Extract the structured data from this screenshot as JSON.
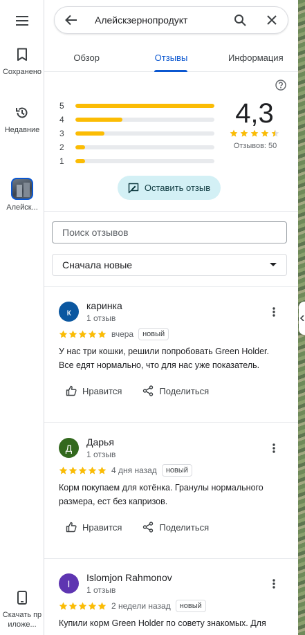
{
  "rail": {
    "saved_label": "Сохранено",
    "recent_label": "Недавние",
    "place_label": "Алейск...",
    "download_label": "Скачать приложе..."
  },
  "search": {
    "query": "Алейскзернопродукт"
  },
  "tabs": [
    {
      "label": "Обзор"
    },
    {
      "label": "Отзывы"
    },
    {
      "label": "Информация"
    }
  ],
  "rating": {
    "score": "4,3",
    "stars": 4.5,
    "count_text": "Отзывов: 50",
    "distribution": [
      {
        "stars": "5",
        "fraction": 1.0
      },
      {
        "stars": "4",
        "fraction": 0.34
      },
      {
        "stars": "3",
        "fraction": 0.21
      },
      {
        "stars": "2",
        "fraction": 0.07
      },
      {
        "stars": "1",
        "fraction": 0.07
      }
    ]
  },
  "write_review_label": "Оставить отзыв",
  "review_search_placeholder": "Поиск отзывов",
  "sort_label": "Сначала новые",
  "colors": {
    "accent": "#0b57d0",
    "star": "#fbbc04",
    "avatar_1": "#0b57a0",
    "avatar_2": "#33691e",
    "avatar_3": "#5e35b1"
  },
  "reviews": [
    {
      "initial": "к",
      "name": "каринка",
      "count": "1 отзыв",
      "stars": 5,
      "date": "вчера",
      "badge": "новый",
      "text": "У нас три кошки, решили попробовать Green Holder. Все едят нормально, что для нас уже показатель.",
      "like_label": "Нравится",
      "share_label": "Поделиться"
    },
    {
      "initial": "Д",
      "name": "Дарья",
      "count": "1 отзыв",
      "stars": 5,
      "date": "4 дня назад",
      "badge": "новый",
      "text": "Корм покупаем для котёнка. Гранулы нормального размера, ест без капризов.",
      "like_label": "Нравится",
      "share_label": "Поделиться"
    },
    {
      "initial": "I",
      "name": "Islomjon Rahmonov",
      "count": "1 отзыв",
      "stars": 5,
      "date": "2 недели назад",
      "badge": "новый",
      "text": "Купили корм Green Holder по совету знакомых. Для",
      "like_label": "Нравится",
      "share_label": "Поделиться"
    }
  ]
}
